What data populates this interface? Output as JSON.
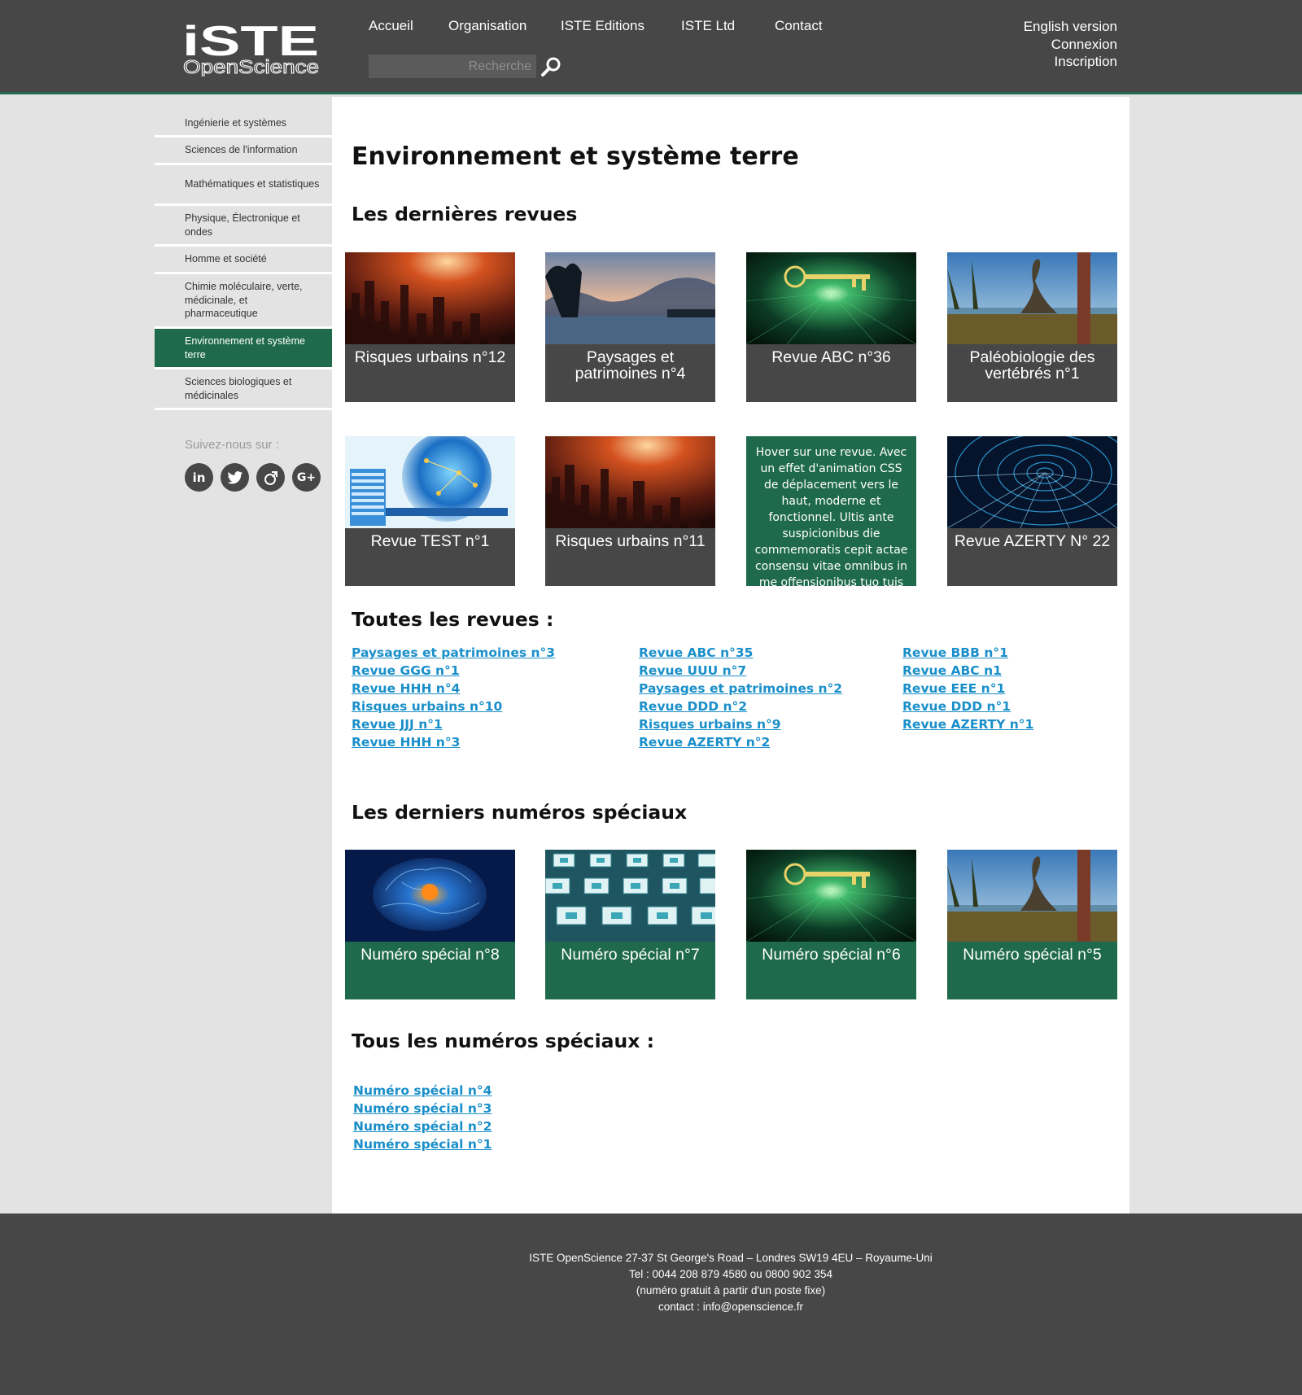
{
  "header": {
    "logo_top": "iSTE",
    "logo_bottom": "OpenScience",
    "nav": [
      "Accueil",
      "Organisation",
      "ISTE Editions",
      "ISTE Ltd",
      "Contact"
    ],
    "search_placeholder": "Recherche",
    "account": [
      "English version",
      "Connexion",
      "Inscription"
    ]
  },
  "sidebar": {
    "items": [
      "Ingénierie et systèmes",
      "Sciences de l'information",
      "Mathématiques et statistiques",
      "Physique, Électronique et ondes",
      "Homme et société",
      "Chimie moléculaire, verte, médicinale, et pharmaceutique",
      "Environnement et système terre",
      "Sciences biologiques et médicinales"
    ],
    "active_index": 6,
    "follow_label": "Suivez-nous sur :",
    "socials": [
      "linkedin-icon",
      "twitter-icon",
      "viadeo-icon",
      "google-plus-icon"
    ],
    "social_glyphs": [
      "in",
      "🐦",
      "♂",
      "G+"
    ]
  },
  "main": {
    "title": "Environnement et système terre",
    "latest_heading": "Les dernières revues",
    "latest": [
      {
        "title": "Risques urbains n°12",
        "image": "city-sunset"
      },
      {
        "title": "Paysages et patrimoines n°4",
        "image": "lake-landscape"
      },
      {
        "title": "Revue ABC n°36",
        "image": "digital-key"
      },
      {
        "title": "Paléobiologie des vertébrés n°1",
        "image": "dinosaur-scene"
      },
      {
        "title": "Revue TEST n°1",
        "image": "server-globe"
      },
      {
        "title": "Risques urbains n°11",
        "image": "city-sunset"
      },
      {
        "title": "",
        "image": "",
        "hover_text": "Hover sur une revue. Avec un effet d'animation CSS de déplacement vers le haut, moderne et fonctionnel. Ultis ante suspicionibus die commemoratis cepit actae consensu vitae omnibus in me offensionibus tuo tuis"
      },
      {
        "title": "Revue AZERTY N° 22",
        "image": "blue-tunnel"
      }
    ],
    "all_heading": "Toutes les revues :",
    "all_columns": [
      [
        "Paysages et patrimoines n°3",
        "Revue GGG n°1",
        "Revue HHH n°4",
        "Risques urbains n°10",
        "Revue JJJ n°1",
        "Revue HHH n°3"
      ],
      [
        "Revue ABC n°35",
        "Revue UUU n°7",
        "Paysages et patrimoines n°2",
        "Revue DDD n°2",
        "Risques urbains n°9",
        "Revue AZERTY n°2"
      ],
      [
        "Revue BBB n°1",
        "Revue ABC n1",
        "Revue EEE n°1",
        "Revue DDD n°1",
        "Revue AZERTY n°1"
      ]
    ],
    "special_heading": "Les derniers numéros spéciaux",
    "specials": [
      {
        "title": "Numéro spécial n°8",
        "image": "brain"
      },
      {
        "title": "Numéro spécial n°7",
        "image": "circuit-chips"
      },
      {
        "title": "Numéro spécial n°6",
        "image": "digital-key"
      },
      {
        "title": "Numéro spécial n°5",
        "image": "dinosaur-scene"
      }
    ],
    "all_special_heading": "Tous les numéros spéciaux :",
    "all_specials": [
      "Numéro spécial n°4",
      "Numéro spécial n°3",
      "Numéro spécial n°2",
      "Numéro spécial n°1"
    ]
  },
  "footer": {
    "lines": [
      "ISTE OpenScience 27-37 St George's Road – Londres SW19 4EU – Royaume-Uni",
      "Tel : 0044 208 879 4580 ou 0800 902 354",
      "(numéro gratuit à partir d'un poste fixe)",
      "contact : info@openscience.fr"
    ]
  },
  "colors": {
    "header_bg": "#474747",
    "accent_green": "#1f6a4d",
    "link_blue": "#1a8fc9",
    "page_bg": "#e3e3e3"
  }
}
